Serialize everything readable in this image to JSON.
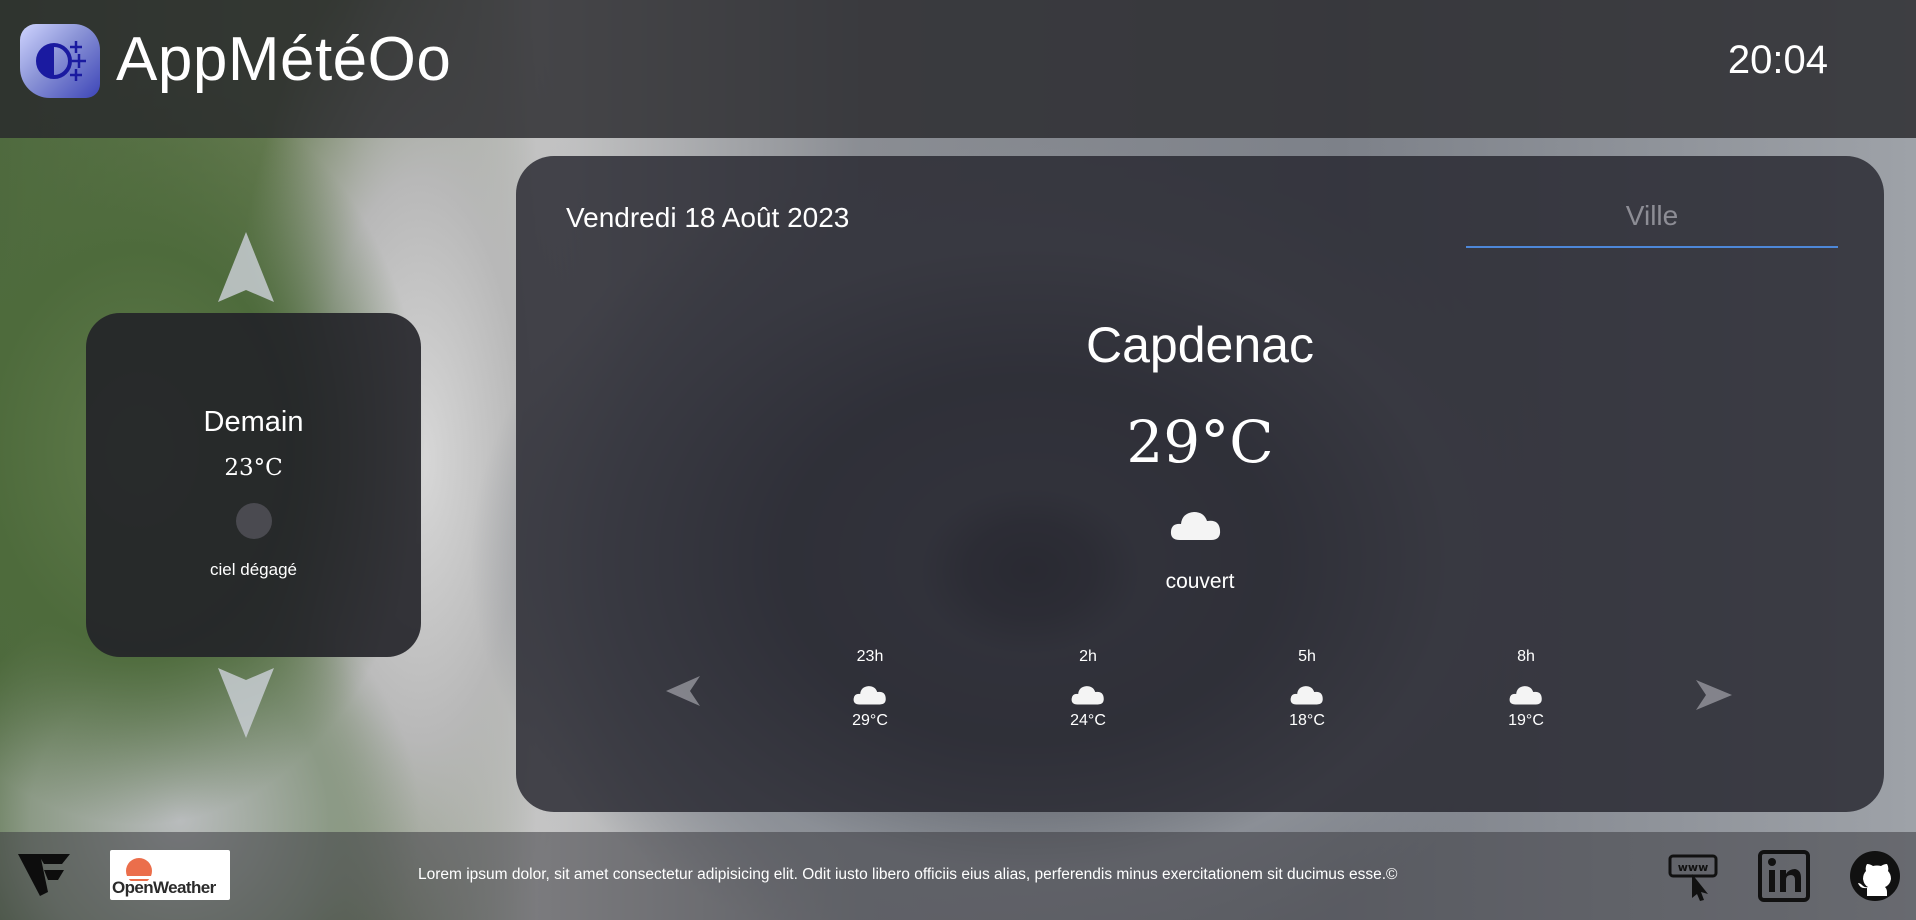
{
  "header": {
    "title": "AppMétéOo",
    "time": "20:04",
    "logo_icon": "weather-app-logo-icon"
  },
  "tomorrow": {
    "title": "Demain",
    "temperature": "23°C",
    "description": "ciel dégagé",
    "up_arrow_icon": "arrow-up-icon",
    "down_arrow_icon": "arrow-down-icon"
  },
  "current": {
    "date": "Vendredi 18 Août 2023",
    "search_placeholder": "Ville",
    "city": "Capdenac",
    "temperature": "29°C",
    "description": "couvert",
    "icon": "cloud-icon"
  },
  "hourly": [
    {
      "hour": "23h",
      "temp": "29°C",
      "icon": "cloud-icon"
    },
    {
      "hour": "2h",
      "temp": "24°C",
      "icon": "cloud-icon"
    },
    {
      "hour": "5h",
      "temp": "18°C",
      "icon": "cloud-icon"
    },
    {
      "hour": "8h",
      "temp": "19°C",
      "icon": "cloud-icon"
    }
  ],
  "footer": {
    "text": "Lorem ipsum dolor, sit amet consectetur adipisicing elit. Odit iusto libero officiis eius alias, perferendis minus exercitationem sit ducimus esse.©",
    "openweather_label": "OpenWeather",
    "icons": [
      "website-icon",
      "linkedin-icon",
      "github-icon"
    ]
  },
  "colors": {
    "accent": "#4d87d8",
    "openweather_orange": "#eb6e4b"
  }
}
